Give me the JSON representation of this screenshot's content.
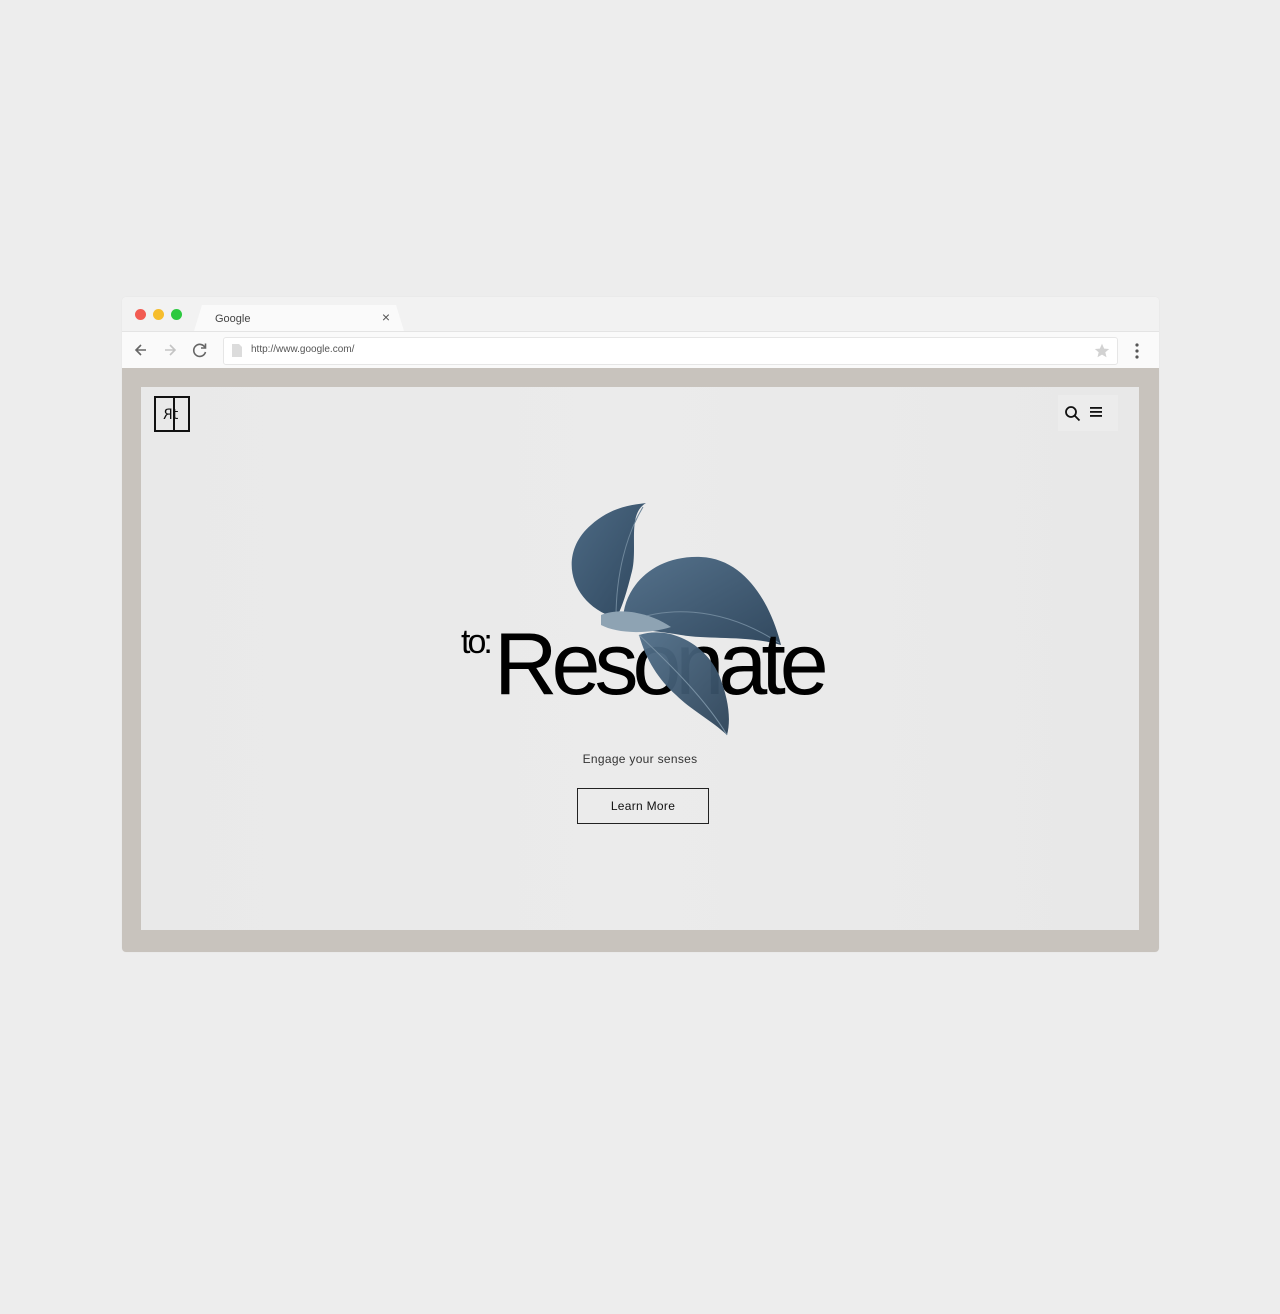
{
  "browser": {
    "window_controls": {
      "close_color": "#f25b52",
      "minimize_color": "#f6bd2c",
      "maximize_color": "#2cc93f"
    },
    "tab": {
      "title": "Google",
      "close_glyph": "×"
    },
    "toolbar": {
      "back_icon": "arrow-left-icon",
      "forward_icon": "arrow-right-icon",
      "reload_icon": "reload-icon",
      "url": "http://www.google.com/",
      "bookmark_icon": "star-icon",
      "menu_icon": "kebab-menu-icon"
    },
    "frame_color": "#c8c3bd"
  },
  "site": {
    "logo": {
      "text": "Rt",
      "icon": "brand-logo"
    },
    "header": {
      "search_icon": "search-icon",
      "menu_icon": "hamburger-menu-icon"
    },
    "hero": {
      "prefix": "to:",
      "title": "Resonate",
      "image": "blue-leaves-illustration",
      "leaf_color": "#3e5a73",
      "tagline": "Engage your senses",
      "cta_label": "Learn More"
    }
  }
}
